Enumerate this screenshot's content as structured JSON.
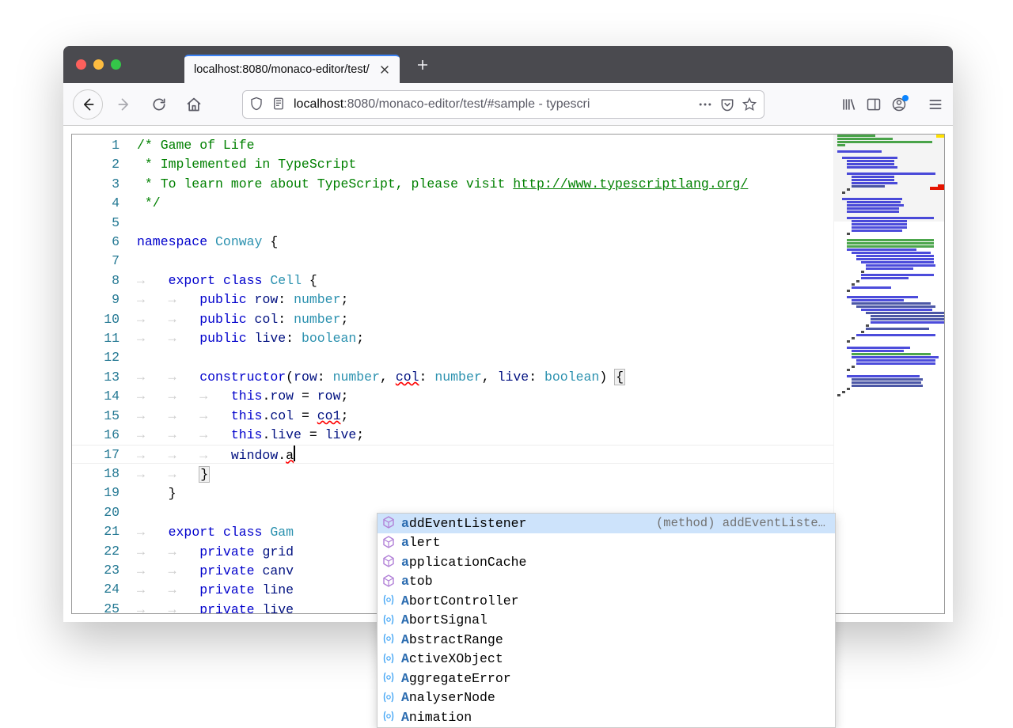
{
  "browser": {
    "tab_title": "localhost:8080/monaco-editor/test/",
    "url_display_host": "localhost",
    "url_display_port": ":8080",
    "url_display_path": "/monaco-editor/test/#sample - typescri"
  },
  "editor": {
    "line_count": 25,
    "tokens": [
      [
        {
          "t": "/* Game of Life",
          "c": "c-comment"
        }
      ],
      [
        {
          "t": " * Implemented in TypeScript",
          "c": "c-comment"
        }
      ],
      [
        {
          "t": " * To learn more about TypeScript, please visit ",
          "c": "c-comment"
        },
        {
          "t": "http://www.typescriptlang.org/",
          "c": "c-link"
        }
      ],
      [
        {
          "t": " */",
          "c": "c-comment"
        }
      ],
      [],
      [
        {
          "t": "namespace",
          "c": "c-keyword"
        },
        {
          "t": " "
        },
        {
          "t": "Conway",
          "c": "c-class"
        },
        {
          "t": " {"
        }
      ],
      [],
      [
        {
          "t": "    "
        },
        {
          "t": "export",
          "c": "c-keyword"
        },
        {
          "t": " "
        },
        {
          "t": "class",
          "c": "c-keyword"
        },
        {
          "t": " "
        },
        {
          "t": "Cell",
          "c": "c-type"
        },
        {
          "t": " {"
        }
      ],
      [
        {
          "t": "        "
        },
        {
          "t": "public",
          "c": "c-keyword"
        },
        {
          "t": " "
        },
        {
          "t": "row",
          "c": "c-prop"
        },
        {
          "t": ": "
        },
        {
          "t": "number",
          "c": "c-type"
        },
        {
          "t": ";"
        }
      ],
      [
        {
          "t": "        "
        },
        {
          "t": "public",
          "c": "c-keyword"
        },
        {
          "t": " "
        },
        {
          "t": "col",
          "c": "c-prop"
        },
        {
          "t": ": "
        },
        {
          "t": "number",
          "c": "c-type"
        },
        {
          "t": ";"
        }
      ],
      [
        {
          "t": "        "
        },
        {
          "t": "public",
          "c": "c-keyword"
        },
        {
          "t": " "
        },
        {
          "t": "live",
          "c": "c-prop"
        },
        {
          "t": ": "
        },
        {
          "t": "boolean",
          "c": "c-type"
        },
        {
          "t": ";"
        }
      ],
      [],
      [
        {
          "t": "        "
        },
        {
          "t": "constructor",
          "c": "c-keyword"
        },
        {
          "t": "("
        },
        {
          "t": "row",
          "c": "c-local"
        },
        {
          "t": ": "
        },
        {
          "t": "number",
          "c": "c-type"
        },
        {
          "t": ", "
        },
        {
          "t": "col",
          "c": "c-local err"
        },
        {
          "t": ": "
        },
        {
          "t": "number",
          "c": "c-type"
        },
        {
          "t": ", "
        },
        {
          "t": "live",
          "c": "c-local"
        },
        {
          "t": ": "
        },
        {
          "t": "boolean",
          "c": "c-type"
        },
        {
          "t": ") "
        },
        {
          "t": "{",
          "c": "brmatch"
        }
      ],
      [
        {
          "t": "            "
        },
        {
          "t": "this",
          "c": "c-keyword"
        },
        {
          "t": "."
        },
        {
          "t": "row",
          "c": "c-prop"
        },
        {
          "t": " = "
        },
        {
          "t": "row",
          "c": "c-local"
        },
        {
          "t": ";"
        }
      ],
      [
        {
          "t": "            "
        },
        {
          "t": "this",
          "c": "c-keyword"
        },
        {
          "t": "."
        },
        {
          "t": "col",
          "c": "c-prop"
        },
        {
          "t": " = "
        },
        {
          "t": "co1",
          "c": "c-local err"
        },
        {
          "t": ";"
        }
      ],
      [
        {
          "t": "            "
        },
        {
          "t": "this",
          "c": "c-keyword"
        },
        {
          "t": "."
        },
        {
          "t": "live",
          "c": "c-prop"
        },
        {
          "t": " = "
        },
        {
          "t": "live",
          "c": "c-local"
        },
        {
          "t": ";"
        }
      ],
      [
        {
          "t": "            "
        },
        {
          "t": "window",
          "c": "c-local"
        },
        {
          "t": "."
        },
        {
          "t": "a",
          "c": "c-ident err"
        },
        {
          "t": "",
          "caret": true
        }
      ],
      [
        {
          "t": "        "
        },
        {
          "t": "}",
          "c": "brmatch"
        }
      ],
      [
        {
          "t": "    }"
        }
      ],
      [],
      [
        {
          "t": "    "
        },
        {
          "t": "export",
          "c": "c-keyword"
        },
        {
          "t": " "
        },
        {
          "t": "class",
          "c": "c-keyword"
        },
        {
          "t": " "
        },
        {
          "t": "Gam",
          "c": "c-type"
        }
      ],
      [
        {
          "t": "        "
        },
        {
          "t": "private",
          "c": "c-keyword"
        },
        {
          "t": " "
        },
        {
          "t": "grid",
          "c": "c-prop"
        }
      ],
      [
        {
          "t": "        "
        },
        {
          "t": "private",
          "c": "c-keyword"
        },
        {
          "t": " "
        },
        {
          "t": "canv",
          "c": "c-prop"
        }
      ],
      [
        {
          "t": "        "
        },
        {
          "t": "private",
          "c": "c-keyword"
        },
        {
          "t": " "
        },
        {
          "t": "line",
          "c": "c-prop"
        }
      ],
      [
        {
          "t": "        "
        },
        {
          "t": "private",
          "c": "c-keyword"
        },
        {
          "t": " "
        },
        {
          "t": "live",
          "c": "c-prop"
        }
      ]
    ],
    "minimap_lines": [
      {
        "w": 48,
        "c": "#008000",
        "i": 0
      },
      {
        "w": 70,
        "c": "#008000",
        "i": 0
      },
      {
        "w": 120,
        "c": "#008000",
        "i": 0
      },
      {
        "w": 10,
        "c": "#008000",
        "i": 0
      },
      {
        "w": 0
      },
      {
        "w": 56,
        "c": "#0000cc",
        "i": 0
      },
      {
        "w": 0
      },
      {
        "w": 70,
        "c": "#0000cc",
        "i": 6
      },
      {
        "w": 60,
        "c": "#0000cc",
        "i": 12
      },
      {
        "w": 60,
        "c": "#0000cc",
        "i": 12
      },
      {
        "w": 64,
        "c": "#0000cc",
        "i": 12
      },
      {
        "w": 0
      },
      {
        "w": 112,
        "c": "#0000cc",
        "i": 12
      },
      {
        "w": 54,
        "c": "#0000cc",
        "i": 18
      },
      {
        "w": 54,
        "c": "#0000cc",
        "i": 18
      },
      {
        "w": 58,
        "c": "#0000cc",
        "i": 18
      },
      {
        "w": 42,
        "c": "#001080",
        "i": 18
      },
      {
        "w": 4,
        "c": "#000",
        "i": 12
      },
      {
        "w": 4,
        "c": "#000",
        "i": 6
      },
      {
        "w": 0
      },
      {
        "w": 76,
        "c": "#0000cc",
        "i": 6
      },
      {
        "w": 68,
        "c": "#0000cc",
        "i": 12
      },
      {
        "w": 72,
        "c": "#0000cc",
        "i": 12
      },
      {
        "w": 66,
        "c": "#0000cc",
        "i": 12
      },
      {
        "w": 66,
        "c": "#0000cc",
        "i": 12
      },
      {
        "w": 0
      },
      {
        "w": 110,
        "c": "#0000cc",
        "i": 12
      },
      {
        "w": 70,
        "c": "#0000cc",
        "i": 18
      },
      {
        "w": 70,
        "c": "#0000cc",
        "i": 18
      },
      {
        "w": 70,
        "c": "#0000cc",
        "i": 18
      },
      {
        "w": 64,
        "c": "#0000cc",
        "i": 18
      },
      {
        "w": 4,
        "c": "#000",
        "i": 12
      },
      {
        "w": 0
      },
      {
        "w": 110,
        "c": "#008000",
        "i": 12
      },
      {
        "w": 110,
        "c": "#008000",
        "i": 12
      },
      {
        "w": 110,
        "c": "#008000",
        "i": 12
      },
      {
        "w": 88,
        "c": "#0000cc",
        "i": 12
      },
      {
        "w": 100,
        "c": "#0000cc",
        "i": 18
      },
      {
        "w": 98,
        "c": "#0000cc",
        "i": 24
      },
      {
        "w": 98,
        "c": "#0000cc",
        "i": 24
      },
      {
        "w": 92,
        "c": "#0000cc",
        "i": 30
      },
      {
        "w": 88,
        "c": "#0000cc",
        "i": 36
      },
      {
        "w": 60,
        "c": "#0000cc",
        "i": 36
      },
      {
        "w": 4,
        "c": "#000",
        "i": 30
      },
      {
        "w": 92,
        "c": "#0000cc",
        "i": 30
      },
      {
        "w": 60,
        "c": "#0000cc",
        "i": 30
      },
      {
        "w": 4,
        "c": "#000",
        "i": 24
      },
      {
        "w": 4,
        "c": "#000",
        "i": 18
      },
      {
        "w": 50,
        "c": "#0000cc",
        "i": 18
      },
      {
        "w": 4,
        "c": "#000",
        "i": 12
      },
      {
        "w": 0
      },
      {
        "w": 90,
        "c": "#0000cc",
        "i": 12
      },
      {
        "w": 66,
        "c": "#0000cc",
        "i": 18
      },
      {
        "w": 100,
        "c": "#001080",
        "i": 18
      },
      {
        "w": 100,
        "c": "#001080",
        "i": 24
      },
      {
        "w": 90,
        "c": "#0000cc",
        "i": 30
      },
      {
        "w": 100,
        "c": "#001080",
        "i": 36
      },
      {
        "w": 96,
        "c": "#001080",
        "i": 42
      },
      {
        "w": 94,
        "c": "#001080",
        "i": 42
      },
      {
        "w": 100,
        "c": "#0000cc",
        "i": 42
      },
      {
        "w": 4,
        "c": "#000",
        "i": 36
      },
      {
        "w": 80,
        "c": "#001080",
        "i": 36
      },
      {
        "w": 4,
        "c": "#000",
        "i": 30
      },
      {
        "w": 100,
        "c": "#0000cc",
        "i": 24
      },
      {
        "w": 4,
        "c": "#000",
        "i": 18
      },
      {
        "w": 4,
        "c": "#000",
        "i": 12
      },
      {
        "w": 0
      },
      {
        "w": 80,
        "c": "#0000cc",
        "i": 12
      },
      {
        "w": 66,
        "c": "#0000cc",
        "i": 18
      },
      {
        "w": 100,
        "c": "#008000",
        "i": 18
      },
      {
        "w": 110,
        "c": "#0000cc",
        "i": 18
      },
      {
        "w": 100,
        "c": "#0000cc",
        "i": 24
      },
      {
        "w": 100,
        "c": "#0000cc",
        "i": 24
      },
      {
        "w": 4,
        "c": "#000",
        "i": 18
      },
      {
        "w": 4,
        "c": "#000",
        "i": 12
      },
      {
        "w": 0
      },
      {
        "w": 92,
        "c": "#0000cc",
        "i": 12
      },
      {
        "w": 90,
        "c": "#001080",
        "i": 18
      },
      {
        "w": 88,
        "c": "#001080",
        "i": 18
      },
      {
        "w": 90,
        "c": "#001080",
        "i": 18
      },
      {
        "w": 4,
        "c": "#000",
        "i": 12
      },
      {
        "w": 4,
        "c": "#000",
        "i": 6
      },
      {
        "w": 4,
        "c": "#000",
        "i": 0
      }
    ]
  },
  "suggest": {
    "items": [
      {
        "kind": "method",
        "label": "addEventListener",
        "match": 1,
        "detail": "(method) addEventListen…"
      },
      {
        "kind": "method",
        "label": "alert",
        "match": 1
      },
      {
        "kind": "method",
        "label": "applicationCache",
        "match": 1
      },
      {
        "kind": "method",
        "label": "atob",
        "match": 1
      },
      {
        "kind": "var",
        "label": "AbortController",
        "match": 1
      },
      {
        "kind": "var",
        "label": "AbortSignal",
        "match": 1
      },
      {
        "kind": "var",
        "label": "AbstractRange",
        "match": 1
      },
      {
        "kind": "var",
        "label": "ActiveXObject",
        "match": 1
      },
      {
        "kind": "var",
        "label": "AggregateError",
        "match": 1
      },
      {
        "kind": "var",
        "label": "AnalyserNode",
        "match": 1
      },
      {
        "kind": "var",
        "label": "Animation",
        "match": 1
      }
    ]
  }
}
